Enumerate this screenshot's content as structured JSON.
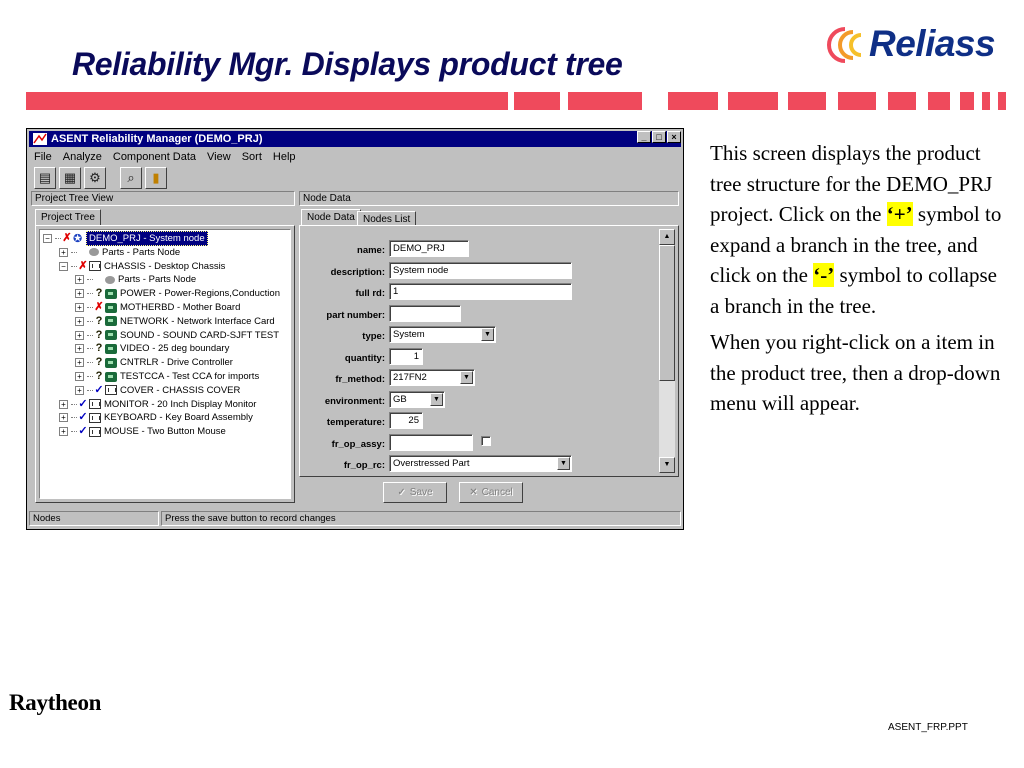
{
  "slide": {
    "title": "Reliability Mgr. Displays product tree",
    "logo_text": "Reliass",
    "footer_brand": "Raytheon",
    "footer_file": "ASENT_FRP.PPT",
    "accent_color": "#ef4a5c"
  },
  "window": {
    "title": "ASENT Reliability Manager (DEMO_PRJ)",
    "controls": [
      "_",
      "□",
      "×"
    ],
    "menu": [
      "File",
      "Analyze",
      "Component Data",
      "View",
      "Sort",
      "Help"
    ],
    "toolbar_icons": [
      "open-icon",
      "calculator-icon",
      "settings-icon",
      "search-icon",
      "exit-icon"
    ]
  },
  "left_panel": {
    "header": "Project Tree View",
    "tab": "Project Tree",
    "tree": [
      {
        "indent": 0,
        "expander": "−",
        "status": "✗",
        "status_type": "x",
        "icon": "gear",
        "text": "DEMO_PRJ  -  System node",
        "selected": true
      },
      {
        "indent": 1,
        "expander": "+",
        "status": "",
        "status_type": "",
        "icon": "parts",
        "text": "Parts  -  Parts Node"
      },
      {
        "indent": 1,
        "expander": "−",
        "status": "✗",
        "status_type": "x",
        "icon": "cube",
        "text": "CHASSIS  -  Desktop Chassis"
      },
      {
        "indent": 2,
        "expander": "+",
        "status": "",
        "status_type": "",
        "icon": "parts",
        "text": "Parts  -  Parts Node"
      },
      {
        "indent": 2,
        "expander": "+",
        "status": "?",
        "status_type": "q",
        "icon": "chip",
        "text": "POWER  -  Power-Regions,Conduction"
      },
      {
        "indent": 2,
        "expander": "+",
        "status": "✗",
        "status_type": "x",
        "icon": "chip",
        "text": "MOTHERBD  -  Mother Board"
      },
      {
        "indent": 2,
        "expander": "+",
        "status": "?",
        "status_type": "q",
        "icon": "chip",
        "text": "NETWORK  -  Network Interface Card"
      },
      {
        "indent": 2,
        "expander": "+",
        "status": "?",
        "status_type": "q",
        "icon": "chip",
        "text": "SOUND  -  SOUND CARD-SJFT TEST"
      },
      {
        "indent": 2,
        "expander": "+",
        "status": "?",
        "status_type": "q",
        "icon": "chip",
        "text": "VIDEO  -  25 deg boundary"
      },
      {
        "indent": 2,
        "expander": "+",
        "status": "?",
        "status_type": "q",
        "icon": "chip",
        "text": "CNTRLR  -  Drive Controller"
      },
      {
        "indent": 2,
        "expander": "+",
        "status": "?",
        "status_type": "q",
        "icon": "chip",
        "text": "TESTCCA  -  Test CCA for imports"
      },
      {
        "indent": 2,
        "expander": "+",
        "status": "✓",
        "status_type": "c",
        "icon": "cube",
        "text": "COVER  -  CHASSIS COVER"
      },
      {
        "indent": 1,
        "expander": "+",
        "status": "✓",
        "status_type": "c",
        "icon": "cube",
        "text": "MONITOR  -  20 Inch Display Monitor"
      },
      {
        "indent": 1,
        "expander": "+",
        "status": "✓",
        "status_type": "c",
        "icon": "cube",
        "text": "KEYBOARD  -  Key Board Assembly"
      },
      {
        "indent": 1,
        "expander": "+",
        "status": "✓",
        "status_type": "c",
        "icon": "cube",
        "text": "MOUSE  -  Two Button Mouse"
      }
    ]
  },
  "right_panel": {
    "header": "Node Data",
    "tabs": [
      "Node Data",
      "Nodes List"
    ],
    "fields": {
      "name": {
        "label": "name:",
        "value": "DEMO_PRJ"
      },
      "description": {
        "label": "description:",
        "value": "System node"
      },
      "full_rd": {
        "label": "full rd:",
        "value": "1"
      },
      "part_number": {
        "label": "part number:",
        "value": ""
      },
      "type": {
        "label": "type:",
        "value": "System"
      },
      "quantity": {
        "label": "quantity:",
        "value": "1"
      },
      "fr_method": {
        "label": "fr_method:",
        "value": "217FN2"
      },
      "environment": {
        "label": "environment:",
        "value": "GB"
      },
      "temperature": {
        "label": "temperature:",
        "value": "25"
      },
      "fr_op_assy": {
        "label": "fr_op_assy:",
        "value": ""
      },
      "fr_op_rc": {
        "label": "fr_op_rc:",
        "value": "Overstressed Part"
      }
    },
    "save_label": "Save",
    "cancel_label": "Cancel"
  },
  "statusbar": {
    "left": "Nodes",
    "message": "Press the save button to record changes"
  },
  "description": {
    "p1_a": "This screen displays the product tree structure for the DEMO_PRJ project. Click on the ",
    "p1_plus": "‘+’",
    "p1_b": " symbol to expand a branch in the tree, and click on the ",
    "p1_minus": "‘-’",
    "p1_c": " symbol to collapse a branch in the tree.",
    "p2": "When you right-click on a item in the product tree, then a drop-down menu will appear."
  }
}
